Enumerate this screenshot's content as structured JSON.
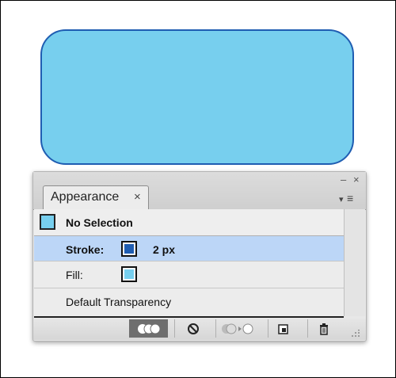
{
  "panel": {
    "tab_label": "Appearance",
    "tab_close_glyph": "×",
    "window_min_glyph": "–",
    "window_close_glyph": "×",
    "menu_glyph": "≡"
  },
  "rows": {
    "selection_label": "No Selection",
    "stroke_label": "Stroke:",
    "stroke_value": "2 px",
    "fill_label": "Fill:",
    "transparency_label": "Default Transparency"
  },
  "colors": {
    "shape_fill": "#77cfee",
    "shape_stroke": "#1f5db2",
    "selected_row": "#bcd6f7"
  },
  "toolbar": {
    "icons": [
      "new-art-icon",
      "clear-appearance-icon",
      "reduce-basic-icon",
      "duplicate-item-icon",
      "trash-icon"
    ]
  }
}
